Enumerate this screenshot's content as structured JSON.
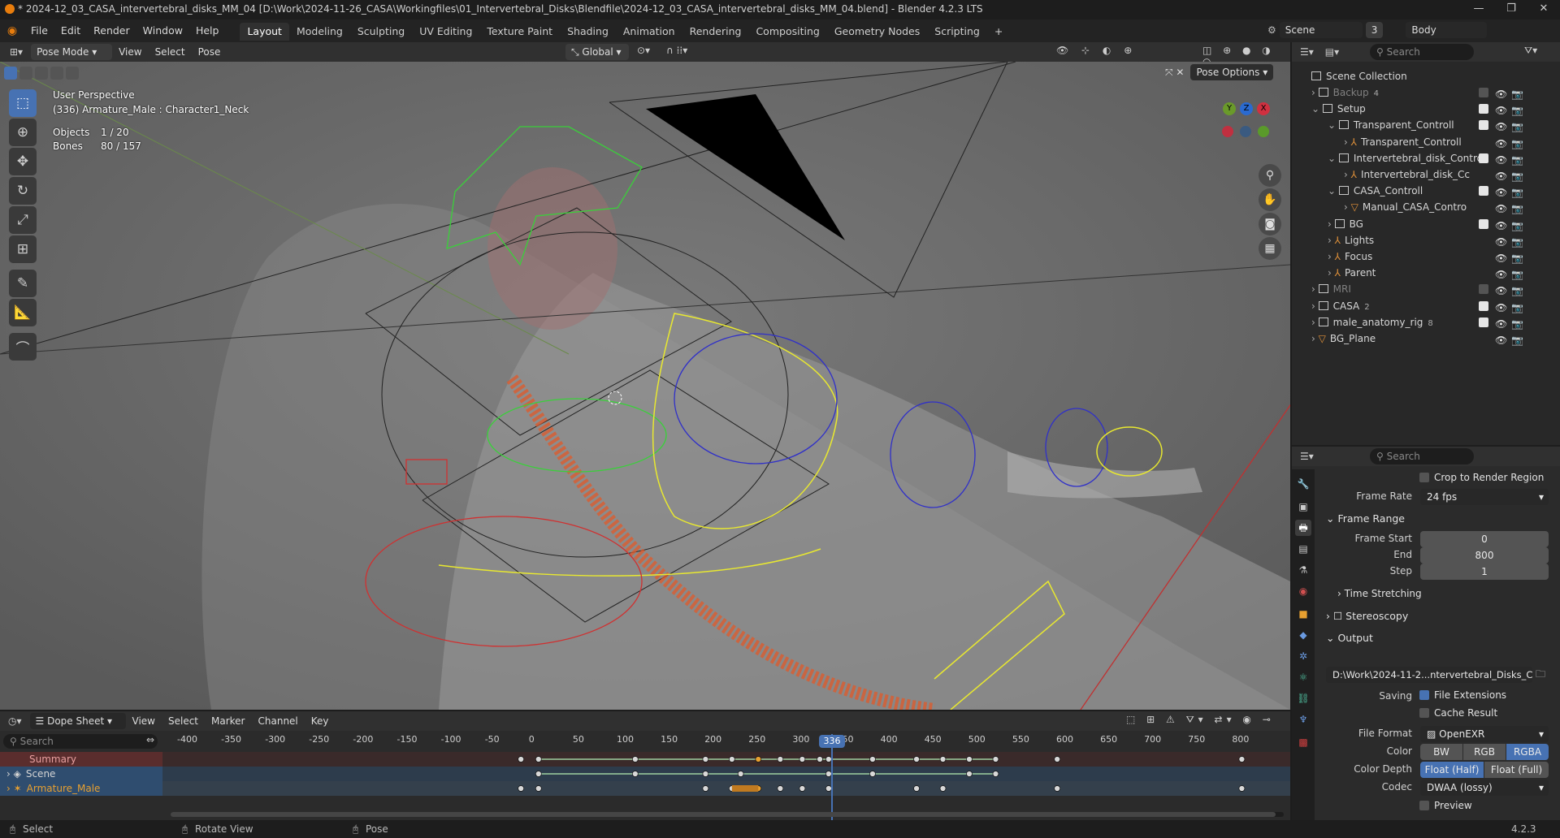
{
  "title": "* 2024-12_03_CASA_intervertebral_disks_MM_04 [D:\\Work\\2024-11-26_CASA\\Workingfiles\\01_Intervertebral_Disks\\Blendfile\\2024-12_03_CASA_intervertebral_disks_MM_04.blend] - Blender 4.2.3 LTS",
  "menu": [
    "File",
    "Edit",
    "Render",
    "Window",
    "Help"
  ],
  "workspaces": [
    "Layout",
    "Modeling",
    "Sculpting",
    "UV Editing",
    "Texture Paint",
    "Shading",
    "Animation",
    "Rendering",
    "Compositing",
    "Geometry Nodes",
    "Scripting"
  ],
  "active_workspace": "Layout",
  "scene": {
    "name": "Scene",
    "users": "3"
  },
  "view_layer": "Body",
  "viewport_header": {
    "mode": "Pose Mode",
    "menus": [
      "View",
      "Select",
      "Pose"
    ],
    "orientation": "Global",
    "pose_options": "Pose Options"
  },
  "viewport_info": {
    "perspective": "User Perspective",
    "active": "(336) Armature_Male : Character1_Neck",
    "objects_label": "Objects",
    "objects": "1 / 20",
    "bones_label": "Bones",
    "bones": "80 / 157"
  },
  "gizmo": {
    "x": "X",
    "y": "Y",
    "z": "Z"
  },
  "outliner": {
    "search_placeholder": "Search",
    "root": "Scene Collection",
    "rows": [
      {
        "label": "Backup",
        "indent": 0,
        "kind": "col",
        "dim": true,
        "badge": "4"
      },
      {
        "label": "Setup",
        "indent": 0,
        "kind": "col",
        "open": true
      },
      {
        "label": "Transparent_Controll",
        "indent": 1,
        "kind": "col",
        "open": true
      },
      {
        "label": "Transparent_Controll",
        "indent": 2,
        "kind": "arm"
      },
      {
        "label": "Intervertebral_disk_Contro",
        "indent": 1,
        "kind": "col",
        "open": true
      },
      {
        "label": "Intervertebral_disk_Cc",
        "indent": 2,
        "kind": "arm"
      },
      {
        "label": "CASA_Controll",
        "indent": 1,
        "kind": "col",
        "open": true
      },
      {
        "label": "Manual_CASA_Contro",
        "indent": 2,
        "kind": "mesh"
      },
      {
        "label": "BG",
        "indent": 1,
        "kind": "col"
      },
      {
        "label": "Lights",
        "indent": 1,
        "kind": "arm"
      },
      {
        "label": "Focus",
        "indent": 1,
        "kind": "arm"
      },
      {
        "label": "Parent",
        "indent": 1,
        "kind": "arm"
      },
      {
        "label": "MRI",
        "indent": 0,
        "kind": "col",
        "dim": true
      },
      {
        "label": "CASA",
        "indent": 0,
        "kind": "col",
        "badge": "2"
      },
      {
        "label": "male_anatomy_rig",
        "indent": 0,
        "kind": "col",
        "badge": "8"
      },
      {
        "label": "BG_Plane",
        "indent": 0,
        "kind": "mesh"
      }
    ]
  },
  "properties": {
    "search_placeholder": "Search",
    "crop": "Crop to Render Region",
    "frame_rate_label": "Frame Rate",
    "frame_rate": "24 fps",
    "frame_range": "Frame Range",
    "frame_start_label": "Frame Start",
    "frame_start": "0",
    "end_label": "End",
    "end": "800",
    "step_label": "Step",
    "step": "1",
    "time_stretching": "Time Stretching",
    "stereoscopy": "Stereoscopy",
    "output": "Output",
    "output_path": "D:\\Work\\2024-11-2...ntervertebral_Disks_C",
    "saving_label": "Saving",
    "file_extensions": "File Extensions",
    "cache_result": "Cache Result",
    "file_format_label": "File Format",
    "file_format": "OpenEXR",
    "color_label": "Color",
    "color_opts": [
      "BW",
      "RGB",
      "RGBA"
    ],
    "color_active": "RGBA",
    "depth_label": "Color Depth",
    "depth_opts": [
      "Float (Half)",
      "Float (Full)"
    ],
    "codec_label": "Codec",
    "codec": "DWAA (lossy)",
    "preview": "Preview"
  },
  "dopesheet": {
    "editor": "Dope Sheet",
    "menus": [
      "View",
      "Select",
      "Marker",
      "Channel",
      "Key"
    ],
    "search_placeholder": "Search",
    "ruler": [
      "-400",
      "-350",
      "-300",
      "-250",
      "-200",
      "-150",
      "-100",
      "-50",
      "0",
      "50",
      "100",
      "150",
      "200",
      "250",
      "300",
      "350",
      "400",
      "450",
      "500",
      "550",
      "600",
      "650",
      "700",
      "750",
      "800"
    ],
    "current_frame": "336",
    "channels": [
      "Summary",
      "Scene",
      "Armature_Male"
    ]
  },
  "status": {
    "select": "Select",
    "rotate": "Rotate View",
    "pose": "Pose",
    "version": "4.2.3"
  }
}
